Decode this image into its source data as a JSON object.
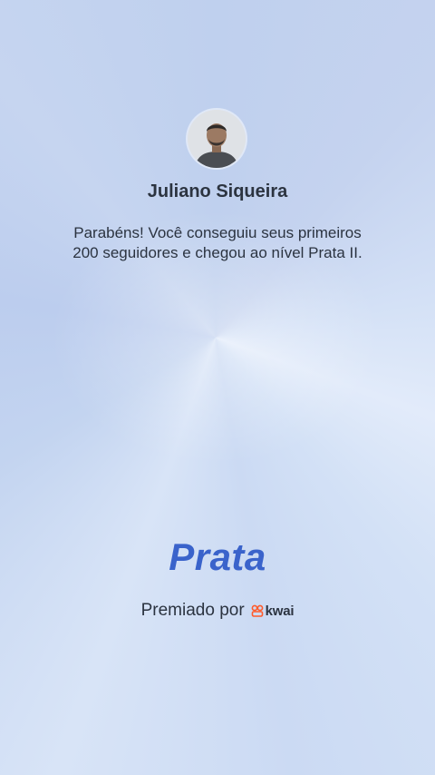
{
  "profile": {
    "name": "Juliano Siqueira"
  },
  "message": {
    "line1": "Parabéns! Você conseguiu seus primeiros",
    "line2": "200 seguidores e chegou ao nível Prata II."
  },
  "level": {
    "title": "Prata"
  },
  "award": {
    "label": "Premiado por",
    "brand": "kwai",
    "brand_icon": "kwai-logo-icon",
    "brand_color": "#ff5a2a"
  },
  "colors": {
    "level_text": "#3a63cb",
    "background": "#c7d6ef"
  }
}
